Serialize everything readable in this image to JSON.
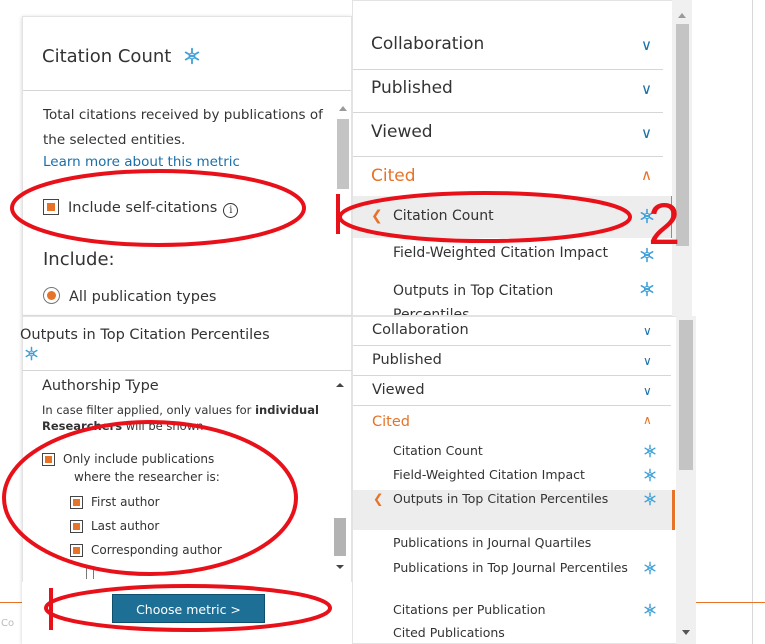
{
  "colors": {
    "accent_orange": "#e67327",
    "link_blue": "#1b6fa8",
    "button_blue": "#1d6f96",
    "annotation_red": "#e8111a",
    "icon_blue": "#3fa0d8"
  },
  "icons": {
    "metric_badge": "snowball-metric-icon",
    "expand": "chevron-down-icon",
    "collapse": "chevron-up-icon",
    "active": "chevron-left-icon",
    "info": "info-icon"
  },
  "top_panel": {
    "title": "Citation Count",
    "description": "Total citations received by publications of the selected entities.",
    "learn_more": "Learn more about this metric",
    "self_citations_label": "Include self-citations",
    "include_heading": "Include:",
    "publication_types_option": "All publication types"
  },
  "top_menu": {
    "items": [
      {
        "label": "Collaboration"
      },
      {
        "label": "Published"
      },
      {
        "label": "Viewed"
      },
      {
        "label": "Cited"
      }
    ],
    "sub_items": [
      {
        "label": "Citation Count",
        "active": true
      },
      {
        "label": "Field-Weighted Citation Impact"
      },
      {
        "label": "Outputs in Top Citation Percentiles"
      }
    ],
    "annotation_number": "2"
  },
  "bottom_panel": {
    "title": "Outputs in Top Citation Percentiles",
    "authorship_heading": "Authorship Type",
    "note_prefix": "In case filter applied, only values for",
    "note_bold": "individual Researchers",
    "note_suffix": "will be shown",
    "only_include_line1": "Only include publications",
    "only_include_line2": "where the researcher is:",
    "first_author": "First author",
    "last_author": "Last author",
    "corresponding_author": "Corresponding author",
    "choose_metric": "Choose metric  >"
  },
  "bottom_menu": {
    "items": [
      {
        "label": "Collaboration"
      },
      {
        "label": "Published"
      },
      {
        "label": "Viewed"
      },
      {
        "label": "Cited"
      }
    ],
    "sub_items": [
      {
        "label": "Citation Count"
      },
      {
        "label": "Field-Weighted Citation Impact"
      },
      {
        "label": "Outputs in Top Citation Percentiles",
        "active": true
      },
      {
        "label": "Publications in Journal Quartiles"
      },
      {
        "label": "Publications in Top Journal Percentiles"
      },
      {
        "label": "Citations per Publication"
      },
      {
        "label": "Cited Publications"
      }
    ]
  },
  "background": {
    "faint_text": "Co"
  }
}
